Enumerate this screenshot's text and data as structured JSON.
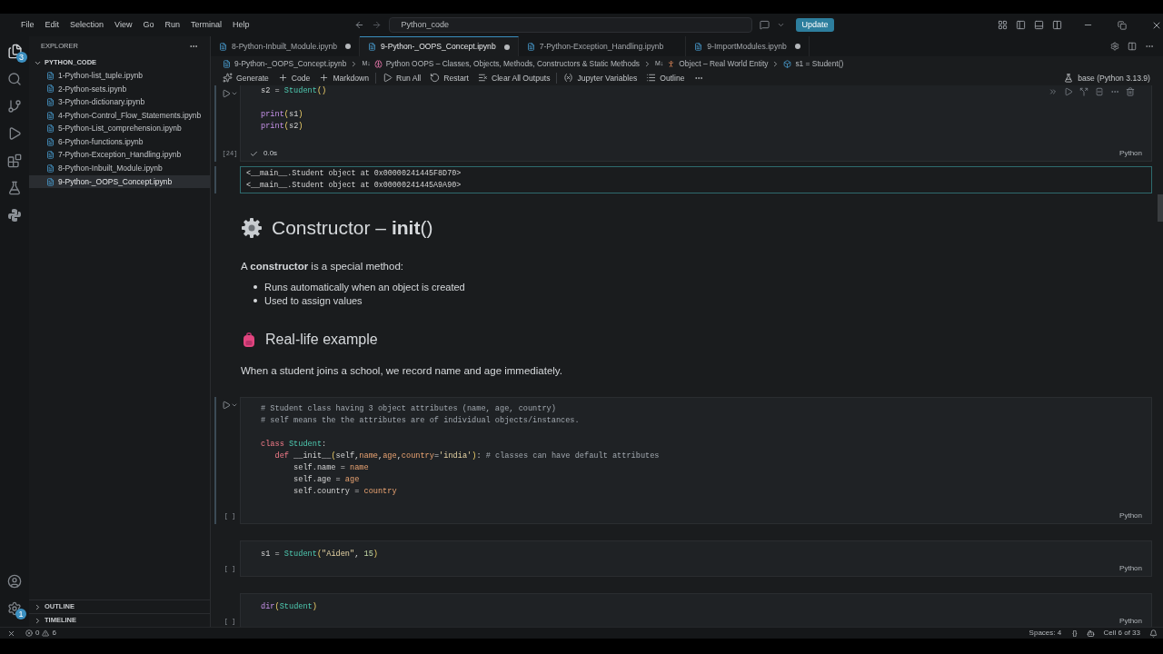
{
  "title_bar": {
    "menus": [
      "File",
      "Edit",
      "Selection",
      "View",
      "Go",
      "Run",
      "Terminal",
      "Help"
    ],
    "search": "Python_code",
    "update_button": "Update"
  },
  "activity_bar": {
    "explorer_badge": "3",
    "settings_badge": "1"
  },
  "sidebar": {
    "title": "EXPLORER",
    "folder": {
      "name": "PYTHON_CODE",
      "expanded": true,
      "files": [
        {
          "name": "1-Python-list_tuple.ipynb",
          "selected": false
        },
        {
          "name": "2-Python-sets.ipynb",
          "selected": false
        },
        {
          "name": "3-Python-dictionary.ipynb",
          "selected": false
        },
        {
          "name": "4-Python-Control_Flow_Statements.ipynb",
          "selected": false
        },
        {
          "name": "5-Python-List_comprehension.ipynb",
          "selected": false
        },
        {
          "name": "6-Python-functions.ipynb",
          "selected": false
        },
        {
          "name": "7-Python-Exception_Handling.ipynb",
          "selected": false
        },
        {
          "name": "8-Python-Inbuilt_Module.ipynb",
          "selected": false
        },
        {
          "name": "9-Python-_OOPS_Concept.ipynb",
          "selected": true
        }
      ]
    },
    "sections": [
      {
        "name": "OUTLINE",
        "expanded": false
      },
      {
        "name": "TIMELINE",
        "expanded": false
      }
    ]
  },
  "tabs": [
    {
      "label": "8-Python-Inbuilt_Module.ipynb",
      "selected": false,
      "modified": true
    },
    {
      "label": "9-Python-_OOPS_Concept.ipynb",
      "selected": true,
      "modified": true
    },
    {
      "label": "7-Python-Exception_Handling.ipynb",
      "selected": false,
      "modified": false
    },
    {
      "label": "9-ImportModules.ipynb",
      "selected": false,
      "modified": true
    }
  ],
  "breadcrumb": [
    {
      "kind": "notebook",
      "text": "9-Python-_OOPS_Concept.ipynb"
    },
    {
      "kind": "markdown",
      "marker": "M↓",
      "text": "Python OOPS – Classes, Objects, Methods, Constructors & Static Methods"
    },
    {
      "kind": "markdown",
      "marker": "M↓",
      "text": "Object – Real World Entity"
    },
    {
      "kind": "code",
      "text": "s1 = Student()"
    }
  ],
  "notebook_toolbar": {
    "actions": [
      {
        "kind": "generate",
        "label": "Generate"
      },
      {
        "kind": "code",
        "label": "Code"
      },
      {
        "kind": "markdown",
        "label": "Markdown"
      },
      {
        "kind": "run_all",
        "label": "Run All"
      },
      {
        "kind": "restart",
        "label": "Restart"
      },
      {
        "kind": "clear",
        "label": "Clear All Outputs"
      },
      {
        "kind": "variables",
        "label": "Jupyter Variables"
      },
      {
        "kind": "outline",
        "label": "Outline"
      }
    ],
    "kernel": "base (Python 3.13.9)"
  },
  "cells": [
    {
      "kind": "code",
      "focused": true,
      "exec_count": "[24]",
      "time": "0.0s",
      "language": "Python",
      "code": [
        [
          [
            {
              "kind": "plain",
              "text": "s2 = "
            },
            {
              "kind": "type",
              "text": "Student"
            },
            {
              "kind": "paren",
              "text": "()"
            }
          ]
        ],
        [
          [
            {
              "kind": "builtin",
              "text": "print"
            },
            {
              "kind": "paren",
              "text": "("
            },
            {
              "kind": "plain",
              "text": "s1"
            },
            {
              "kind": "paren",
              "text": ")"
            }
          ],
          [
            {
              "kind": "builtin",
              "text": "print"
            },
            {
              "kind": "paren",
              "text": "("
            },
            {
              "kind": "plain",
              "text": "s2"
            },
            {
              "kind": "paren",
              "text": ")"
            }
          ]
        ]
      ],
      "output": [
        "<__main__.Student object at 0x00000241445F8D70>",
        "<__main__.Student object at 0x00000241445A9A90>"
      ]
    },
    {
      "kind": "markdown",
      "blocks": [
        {
          "kind": "h1",
          "text": "Constructor – **init**()"
        },
        {
          "kind": "p",
          "text": "A **constructor** is a special method:"
        },
        {
          "kind": "ul",
          "items": [
            "Runs automatically when an object is created",
            "Used to assign values"
          ]
        },
        {
          "kind": "h2",
          "text": "Real-life example"
        },
        {
          "kind": "p",
          "text": "When a student joins a school, we record name and age immediately."
        }
      ]
    },
    {
      "kind": "code",
      "focused": true,
      "exec_count": "[ ]",
      "language": "Python",
      "code": [
        [
          [
            {
              "kind": "comment",
              "text": "# Student class having 3 object attributes (name, age, country)"
            }
          ],
          [
            {
              "kind": "comment",
              "text": "# self means the the attributes are of individual objects/instances."
            }
          ]
        ],
        [
          [
            {
              "kind": "keyword",
              "text": "class "
            },
            {
              "kind": "type",
              "text": "Student"
            },
            {
              "kind": "plain",
              "text": ":"
            }
          ],
          [
            {
              "kind": "keyword",
              "text": "   def"
            },
            {
              "kind": "plain",
              "text": " __init__"
            },
            {
              "kind": "paren",
              "text": "("
            },
            {
              "kind": "plain",
              "text": "self,"
            },
            {
              "kind": "param",
              "text": "name"
            },
            {
              "kind": "plain",
              "text": ","
            },
            {
              "kind": "param",
              "text": "age"
            },
            {
              "kind": "plain",
              "text": ","
            },
            {
              "kind": "param",
              "text": "country"
            },
            {
              "kind": "plain",
              "text": "="
            },
            {
              "kind": "string",
              "text": "'india'"
            },
            {
              "kind": "paren",
              "text": ")"
            },
            {
              "kind": "plain",
              "text": ": "
            },
            {
              "kind": "comment",
              "text": "# classes can have default attributes"
            }
          ],
          [
            {
              "kind": "plain",
              "text": "       self.name = "
            },
            {
              "kind": "param",
              "text": "name"
            }
          ],
          [
            {
              "kind": "plain",
              "text": "       self.age = "
            },
            {
              "kind": "param",
              "text": "age"
            }
          ],
          [
            {
              "kind": "plain",
              "text": "       self.country = "
            },
            {
              "kind": "param",
              "text": "country"
            }
          ]
        ]
      ]
    },
    {
      "kind": "code",
      "focused": false,
      "exec_count": "[ ]",
      "language": "Python",
      "code": [
        [
          [
            {
              "kind": "plain",
              "text": "s1 = "
            },
            {
              "kind": "type",
              "text": "Student"
            },
            {
              "kind": "paren",
              "text": "("
            },
            {
              "kind": "string",
              "text": "\"Aiden\""
            },
            {
              "kind": "plain",
              "text": ", "
            },
            {
              "kind": "number",
              "text": "15"
            },
            {
              "kind": "paren",
              "text": ")"
            }
          ]
        ]
      ]
    },
    {
      "kind": "code",
      "focused": false,
      "exec_count": "[ ]",
      "language": "Python",
      "code": [
        [
          [
            {
              "kind": "builtin",
              "text": "dir"
            },
            {
              "kind": "paren",
              "text": "("
            },
            {
              "kind": "type",
              "text": "Student"
            },
            {
              "kind": "paren",
              "text": ")"
            }
          ]
        ]
      ]
    }
  ],
  "status_bar": {
    "errors": "0",
    "warnings": "6",
    "spaces": "Spaces: 4",
    "braces": "{}",
    "cell": "Cell 6 of 33"
  }
}
